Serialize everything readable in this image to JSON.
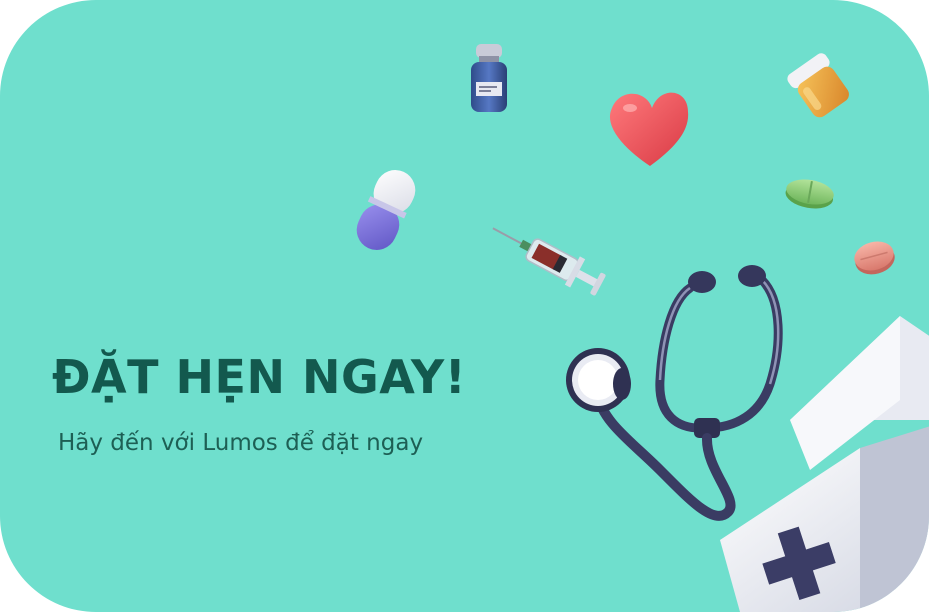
{
  "banner": {
    "headline": "ĐẶT HẸN NGAY!",
    "subline": "Hãy đến với Lumos để đặt ngay"
  },
  "colors": {
    "background": "#6fdfcd",
    "headline": "#13594e",
    "subline": "#1d5f54",
    "heart": "#e8494f",
    "capsule": "#7a6fd8",
    "pill_green": "#8fd07a",
    "pill_pink": "#e9998b",
    "bottle": "#e9a23a",
    "stethoscope": "#3a3c63"
  }
}
